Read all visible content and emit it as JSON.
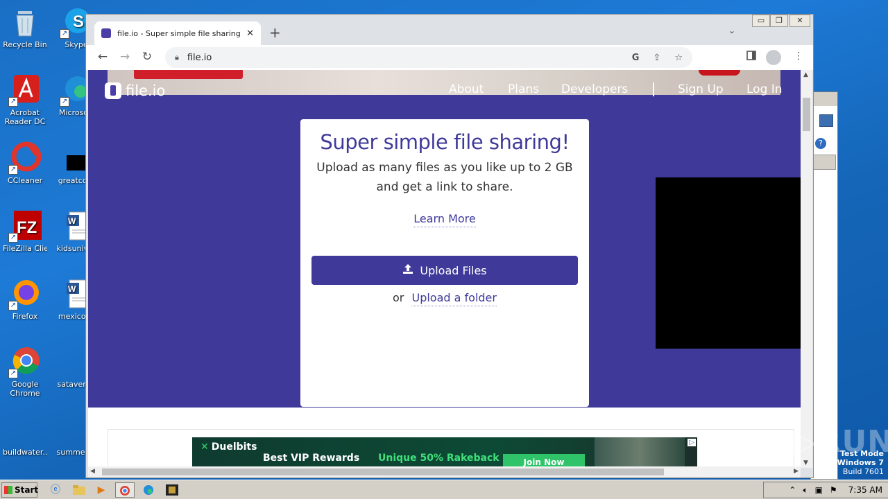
{
  "desktop": {
    "icons": [
      {
        "label": "Recycle Bin"
      },
      {
        "label": "Skype"
      },
      {
        "label": "Acrobat Reader DC"
      },
      {
        "label": "Microsoft"
      },
      {
        "label": "CCleaner"
      },
      {
        "label": "greatcom"
      },
      {
        "label": "FileZilla Client"
      },
      {
        "label": "kidsuniver"
      },
      {
        "label": "Firefox"
      },
      {
        "label": "mexicose"
      },
      {
        "label": "Google Chrome"
      },
      {
        "label": "sataverag"
      },
      {
        "label": "buildwater...."
      },
      {
        "label": "summergr"
      }
    ]
  },
  "browser": {
    "tab_title": "file.io - Super simple file sharing",
    "tab_close": "✕",
    "new_tab": "+",
    "tab_list": "⌄",
    "url": "file.io",
    "nav": {
      "back": "←",
      "forward": "→",
      "reload": "↻"
    },
    "omni_icons": {
      "google": "G",
      "share": "⇪",
      "bookmark": "☆"
    },
    "window_controls": {
      "minimize": "▭",
      "maximize": "❐",
      "close": "✕"
    }
  },
  "page": {
    "logo_text": "file.io",
    "nav_items": [
      "About",
      "Plans",
      "Developers",
      "Sign Up",
      "Log In"
    ],
    "headline": "Super simple file sharing!",
    "sub_line1": "Upload as many files as you like up to 2 GB",
    "sub_line2": "and get a link to share.",
    "learn_more": "Learn More",
    "upload_button": "Upload Files",
    "or_text": "or",
    "upload_folder": "Upload a folder",
    "ad": {
      "brand": "Duelbits",
      "headline": "Best VIP Rewards",
      "offer": "Unique 50% Rakeback",
      "cta": "Join Now",
      "adchoice": "▷"
    }
  },
  "watermark": "ANY▷RUN",
  "test_mode": {
    "line1": "Test Mode",
    "line2": "Windows 7",
    "line3": "Build 7601"
  },
  "taskbar": {
    "start_label": "Start",
    "clock": "7:35 AM"
  },
  "colors": {
    "brand_purple": "#3f3a9a",
    "taskbar": "#d4d0c8",
    "desktop_blue": "#1a6fc4"
  }
}
